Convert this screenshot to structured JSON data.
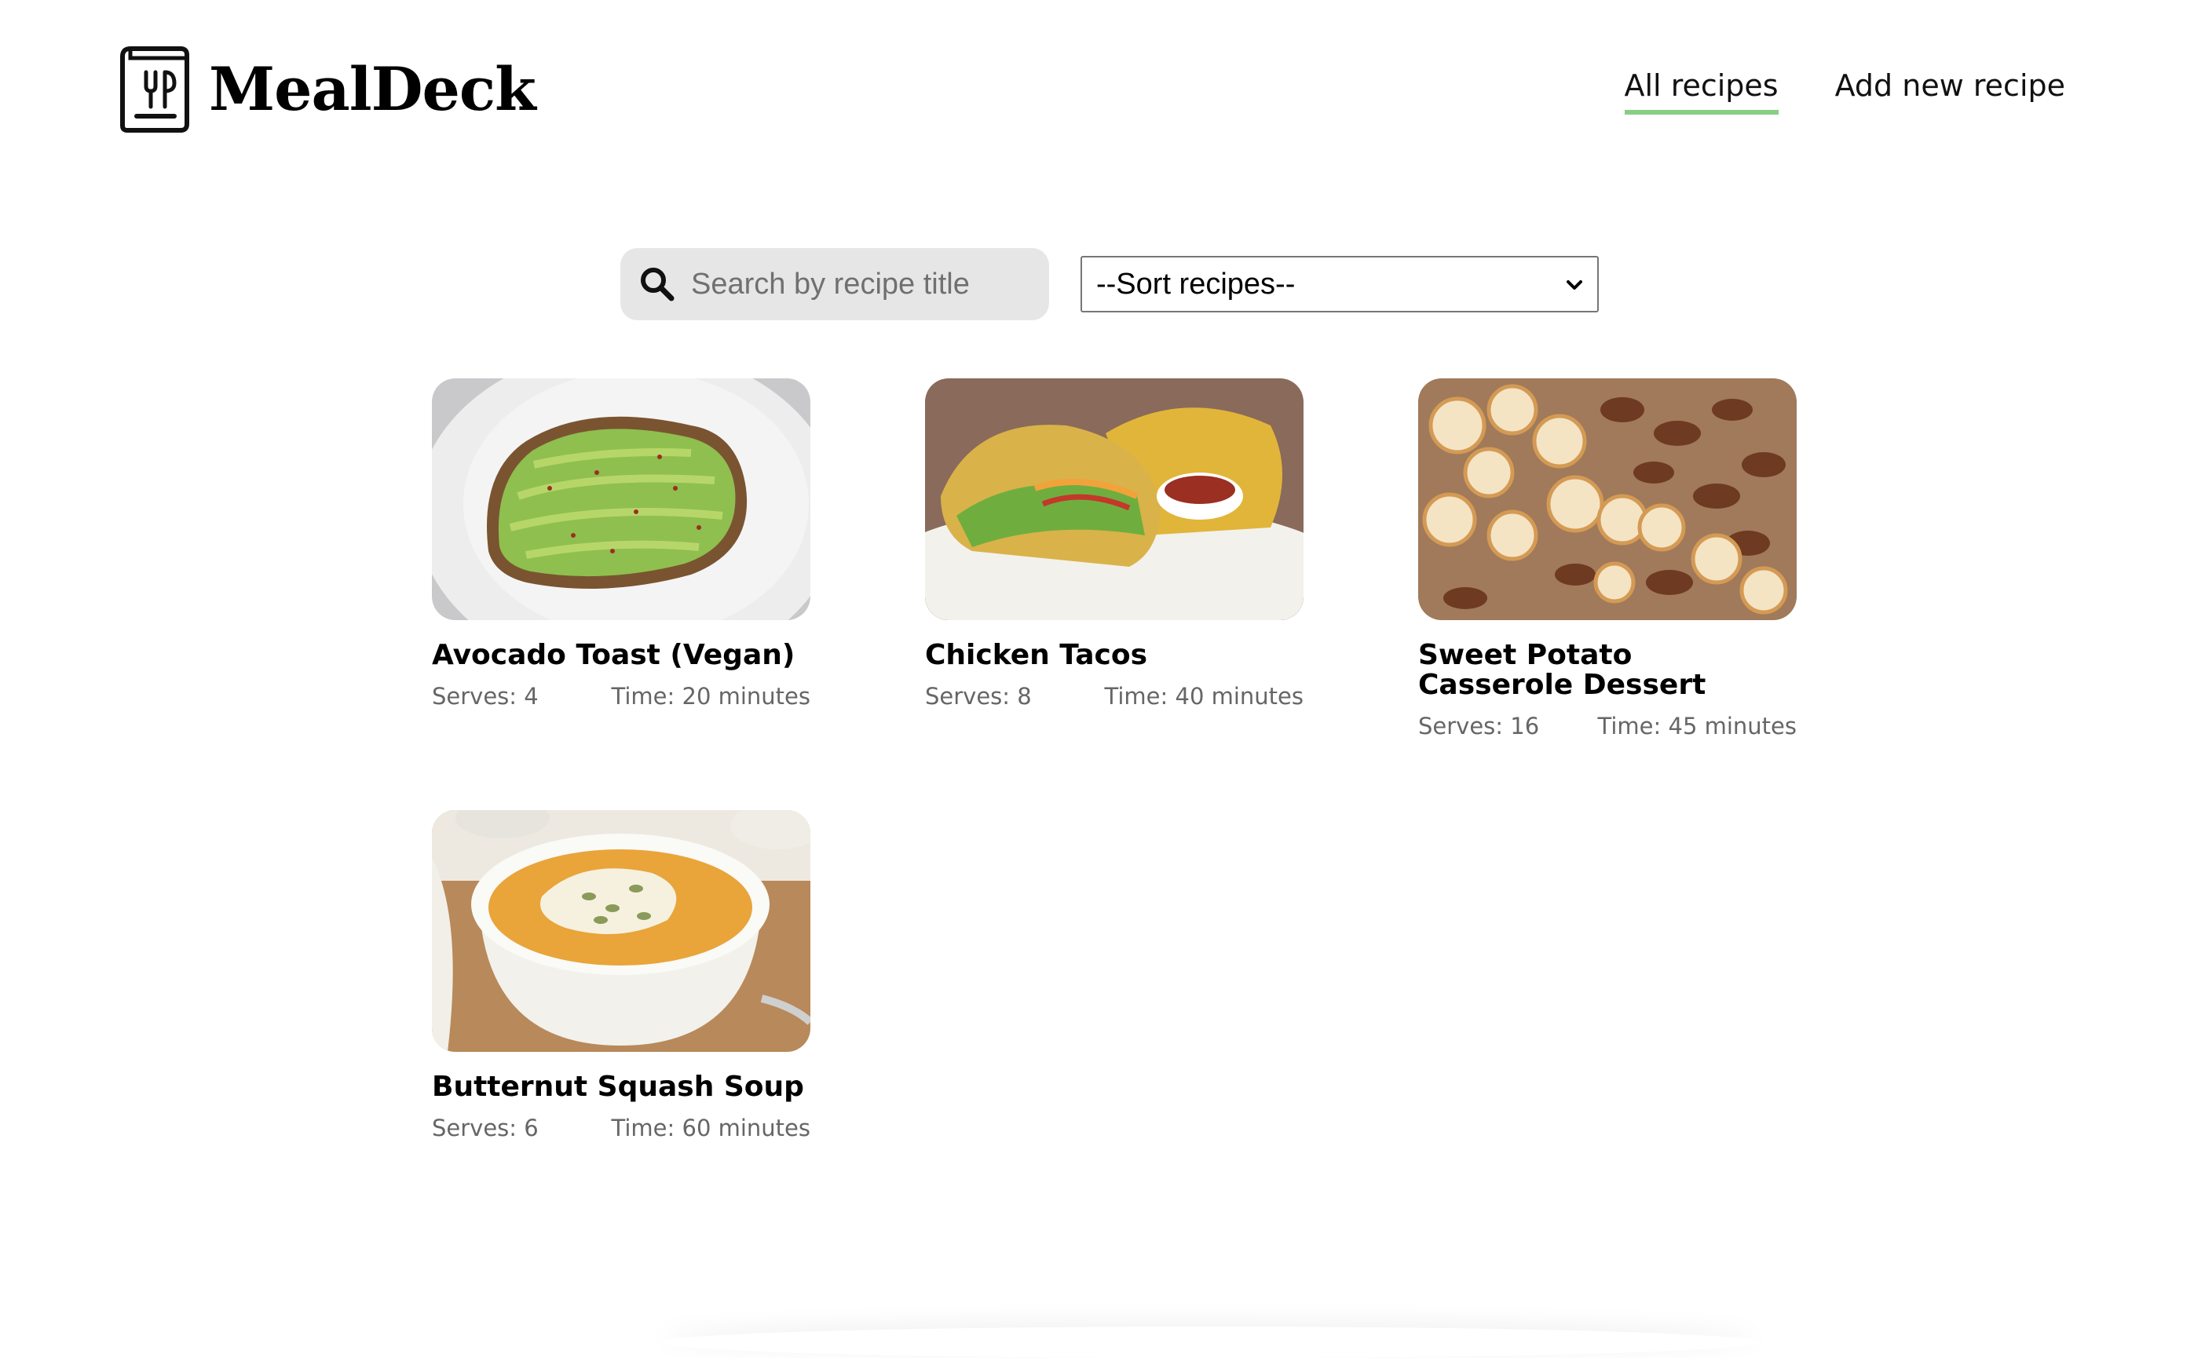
{
  "app": {
    "name": "MealDeck"
  },
  "nav": {
    "all_recipes": "All recipes",
    "add_new_recipe": "Add new recipe",
    "accent_color": "#86cf86"
  },
  "search": {
    "placeholder": "Search by recipe title",
    "value": ""
  },
  "sort": {
    "selected": "--Sort recipes--"
  },
  "recipes": [
    {
      "title": "Avocado Toast (Vegan)",
      "serves": "Serves: 4",
      "time": "Time: 20 minutes"
    },
    {
      "title": "Chicken Tacos",
      "serves": "Serves: 8",
      "time": "Time: 40 minutes"
    },
    {
      "title": "Sweet Potato Casserole Dessert",
      "serves": "Serves: 16",
      "time": "Time: 45 minutes"
    },
    {
      "title": "Butternut Squash Soup",
      "serves": "Serves: 6",
      "time": "Time: 60 minutes"
    }
  ]
}
